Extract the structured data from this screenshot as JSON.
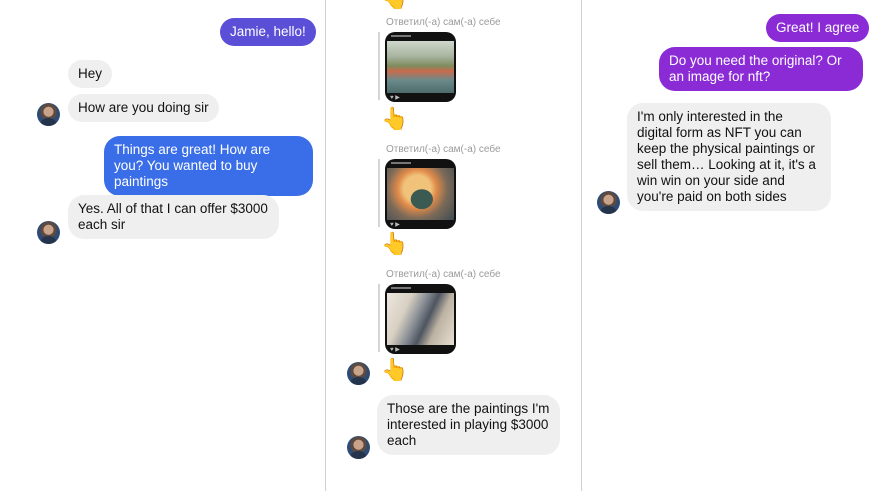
{
  "panel1": {
    "msg_greeting": "Jamie, hello!",
    "msg_hey": "Hey",
    "msg_how_are_you": "How are you doing sir",
    "msg_things_great": "Things are great! How are you? You wanted to buy paintings",
    "msg_offer": "Yes. All of that I can offer $3000 each sir"
  },
  "panel2": {
    "reply_label": "Ответил(-а) сам(-а) себе",
    "reply_emoji": "👆",
    "msg_paintings": "Those are the paintings I'm interested in playing $3000 each"
  },
  "panel3": {
    "msg_agree": "Great! I agree",
    "msg_original": "Do you need the original? Or an image for nft?",
    "msg_nft": "I'm only interested in the digital form as NFT you can keep the physical paintings or sell them… Looking at it, it's a win win on your side and you're paid on both sides"
  },
  "colors": {
    "incoming": "#efefef",
    "outgoing_blue": "#3a6ee8",
    "outgoing_indigo": "#5a4fd6",
    "outgoing_purple": "#8a2bd6",
    "divider": "#cfcfcf"
  }
}
